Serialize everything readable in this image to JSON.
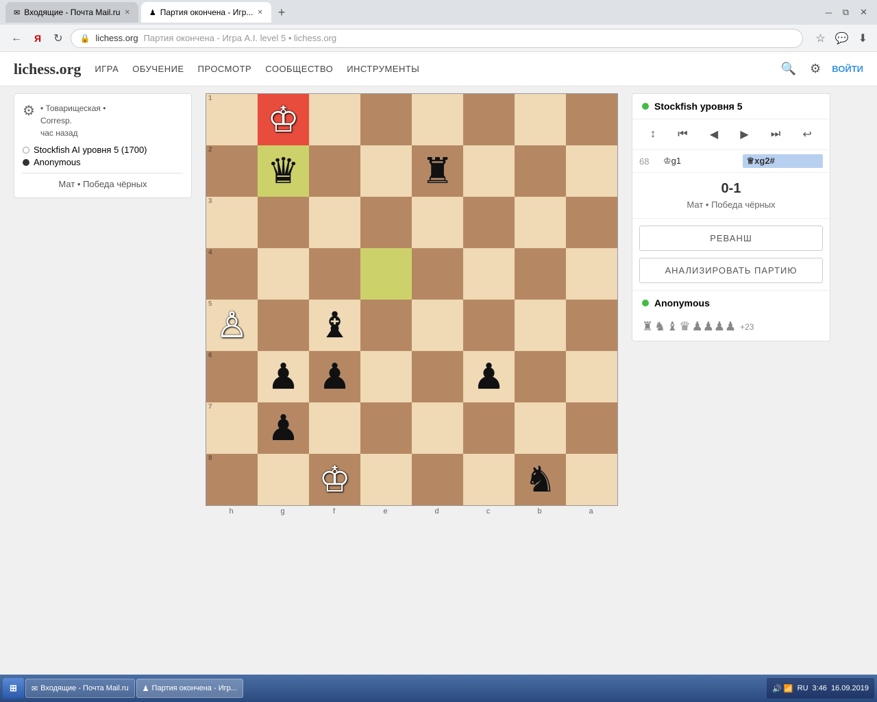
{
  "browser": {
    "tab_inactive": "Входящие - Почта Mail.ru",
    "tab_active": "Партия окончена - Игр...",
    "url_domain": "lichess.org",
    "url_full": "Партия окончена - Игра A.I. level 5 • lichess.org",
    "page_title": "Партия окончена - Игра A.I. level 5 • lichess.org"
  },
  "nav": {
    "logo": "lichess.org",
    "items": [
      "ИГРА",
      "ОБУЧЕНИЕ",
      "ПРОСМОТР",
      "СООБЩЕСТВО",
      "ИНСТРУМЕНТЫ"
    ],
    "login": "ВОЙТИ"
  },
  "game_info": {
    "type": "• Товарищеская •",
    "format": "Corresp.",
    "time_ago": "час назад",
    "player_white": "Stockfish AI уровня 5 (1700)",
    "player_black": "Anonymous",
    "result": "Мат • Победа чёрных"
  },
  "right_panel": {
    "stockfish_label": "Stockfish уровня 5",
    "move_number": "68",
    "move_white": "♔g1",
    "move_black": "♕xg2#",
    "score": "0-1",
    "result_desc": "Мат • Победа чёрных",
    "rematch_btn": "РЕВАНШ",
    "analyze_btn": "АНАЛИЗИРОВАТЬ ПАРТИЮ",
    "anonymous_label": "Anonymous",
    "captured_count": "+23"
  },
  "board": {
    "files": [
      "h",
      "g",
      "f",
      "e",
      "d",
      "c",
      "b",
      "a"
    ]
  },
  "taskbar": {
    "start": "⊞",
    "items": [
      "Входящие - Почта Mail.ru",
      "Партия окончена - Игр..."
    ],
    "time": "3:46",
    "date": "16.09.2019",
    "lang": "RU"
  }
}
